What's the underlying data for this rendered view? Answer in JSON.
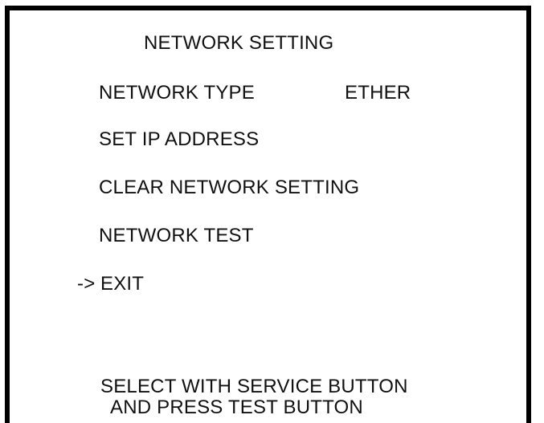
{
  "screen": {
    "title": "NETWORK SETTING",
    "menu": [
      {
        "label": "NETWORK TYPE",
        "value": "ETHER"
      },
      {
        "label": "SET IP ADDRESS"
      },
      {
        "label": "CLEAR NETWORK SETTING"
      },
      {
        "label": "NETWORK TEST"
      },
      {
        "label": "EXIT",
        "selected": true
      }
    ],
    "cursor": "->",
    "instructions": [
      "SELECT WITH SERVICE BUTTON",
      "AND PRESS TEST BUTTON"
    ]
  },
  "colors": {
    "background": "#ffffff",
    "text": "#111111",
    "border": "#000000"
  }
}
